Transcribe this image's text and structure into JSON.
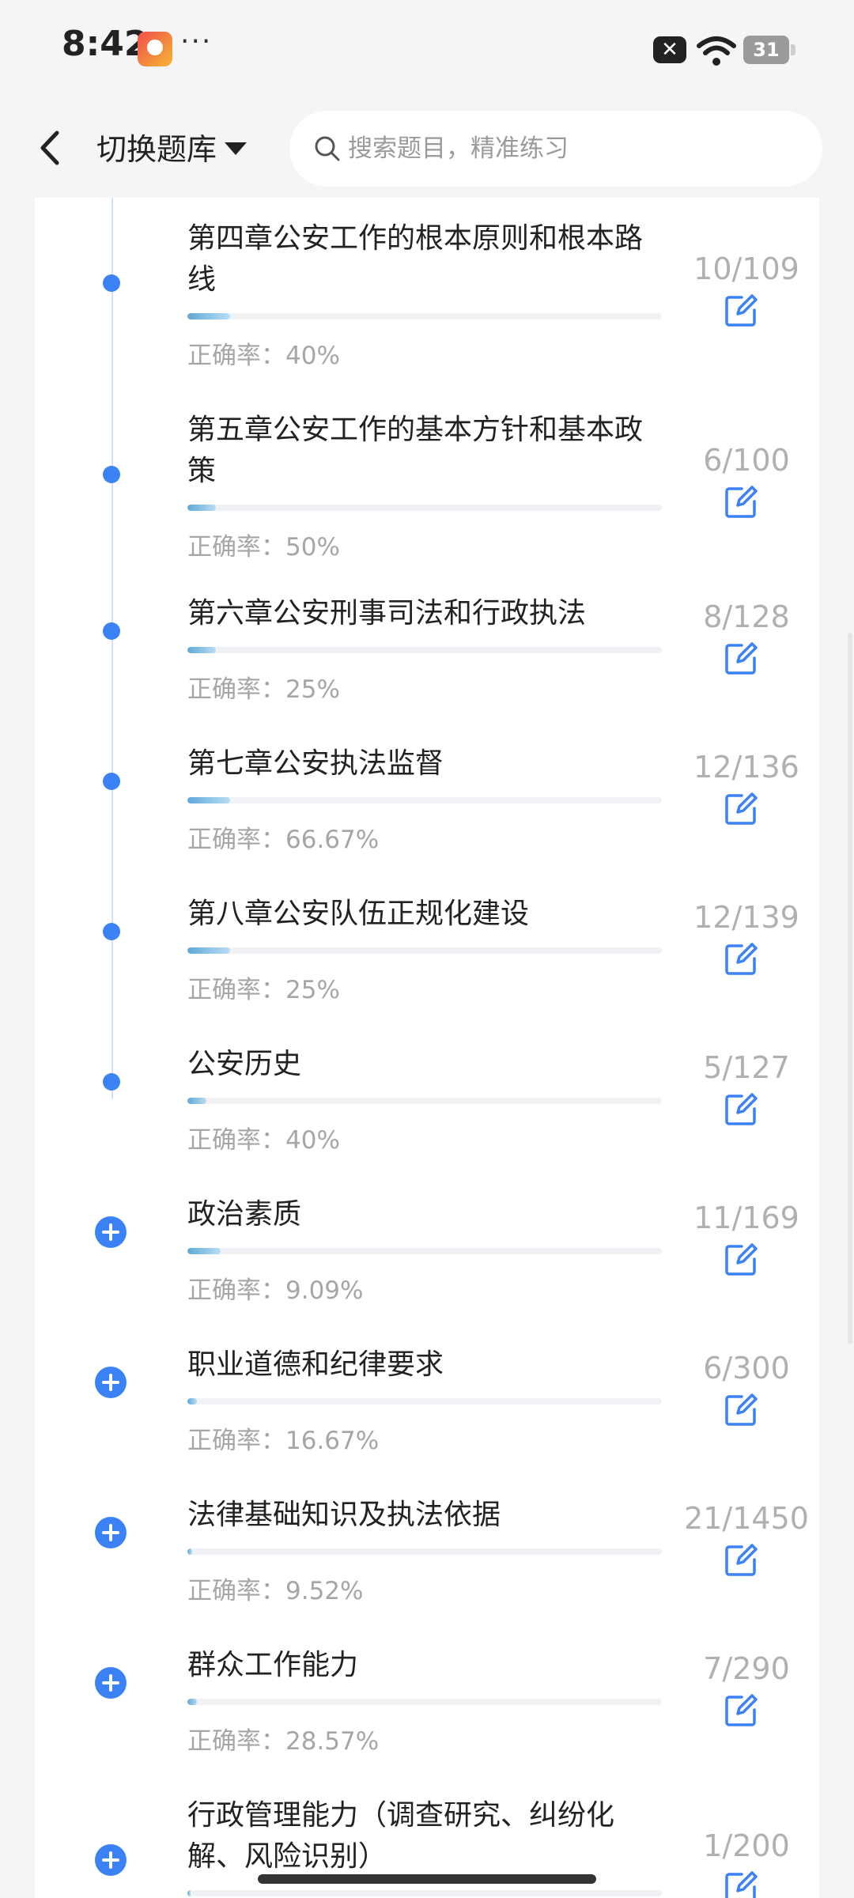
{
  "status_bar": {
    "time": "8:42",
    "dots": "···",
    "x_label": "✕",
    "battery": "31"
  },
  "header": {
    "bank_switch_label": "切换题库",
    "search_placeholder": "搜索题目，精准练习"
  },
  "chapters": [
    {
      "title": "第四章公安工作的根本原则和根本路线",
      "accuracy": "正确率：40%",
      "count": "10/109",
      "progress": 0.09,
      "marker": "dot"
    },
    {
      "title": "第五章公安工作的基本方针和基本政策",
      "accuracy": "正确率：50%",
      "count": "6/100",
      "progress": 0.06,
      "marker": "dot"
    },
    {
      "title": "第六章公安刑事司法和行政执法",
      "accuracy": "正确率：25%",
      "count": "8/128",
      "progress": 0.06,
      "marker": "dot"
    },
    {
      "title": "第七章公安执法监督",
      "accuracy": "正确率：66.67%",
      "count": "12/136",
      "progress": 0.09,
      "marker": "dot"
    },
    {
      "title": "第八章公安队伍正规化建设",
      "accuracy": "正确率：25%",
      "count": "12/139",
      "progress": 0.09,
      "marker": "dot"
    },
    {
      "title": "公安历史",
      "accuracy": "正确率：40%",
      "count": "5/127",
      "progress": 0.04,
      "marker": "dot"
    },
    {
      "title": "政治素质",
      "accuracy": "正确率：9.09%",
      "count": "11/169",
      "progress": 0.07,
      "marker": "plus"
    },
    {
      "title": "职业道德和纪律要求",
      "accuracy": "正确率：16.67%",
      "count": "6/300",
      "progress": 0.02,
      "marker": "plus"
    },
    {
      "title": "法律基础知识及执法依据",
      "accuracy": "正确率：9.52%",
      "count": "21/1450",
      "progress": 0.01,
      "marker": "plus"
    },
    {
      "title": "群众工作能力",
      "accuracy": "正确率：28.57%",
      "count": "7/290",
      "progress": 0.02,
      "marker": "plus"
    },
    {
      "title": "行政管理能力（调查研究、纠纷化解、风险识别）",
      "accuracy": "",
      "count": "1/200",
      "progress": 0.005,
      "marker": "plus"
    }
  ]
}
